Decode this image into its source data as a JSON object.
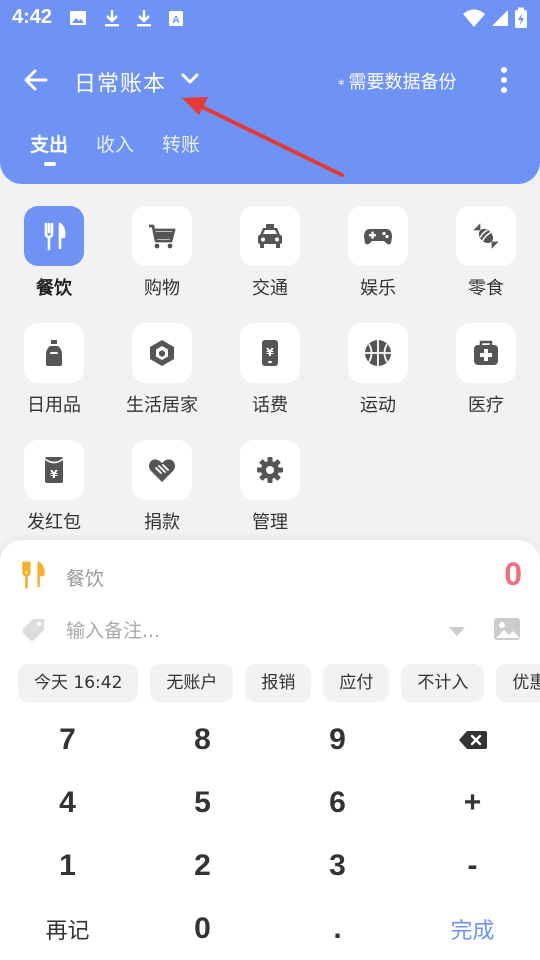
{
  "status": {
    "time": "4:42",
    "icons": [
      "image-icon",
      "download-icon",
      "download-icon",
      "font-icon",
      "wifi-icon",
      "signal-icon",
      "battery-charging-icon"
    ]
  },
  "toolbar": {
    "back_icon": "arrow-left-icon",
    "book_title": "日常账本",
    "backup_star": "⁎",
    "backup_label": "需要数据备份",
    "more_icon": "more-vertical-icon"
  },
  "tabs": [
    {
      "label": "支出",
      "active": true
    },
    {
      "label": "收入",
      "active": false
    },
    {
      "label": "转账",
      "active": false
    }
  ],
  "categories": [
    {
      "label": "餐饮",
      "icon": "utensils-icon",
      "selected": true
    },
    {
      "label": "购物",
      "icon": "cart-icon",
      "selected": false
    },
    {
      "label": "交通",
      "icon": "taxi-icon",
      "selected": false
    },
    {
      "label": "娱乐",
      "icon": "gamepad-icon",
      "selected": false
    },
    {
      "label": "零食",
      "icon": "candy-icon",
      "selected": false
    },
    {
      "label": "日用品",
      "icon": "bottle-icon",
      "selected": false
    },
    {
      "label": "生活居家",
      "icon": "cube-icon",
      "selected": false
    },
    {
      "label": "话费",
      "icon": "phone-bill-icon",
      "selected": false
    },
    {
      "label": "运动",
      "icon": "basketball-icon",
      "selected": false
    },
    {
      "label": "医疗",
      "icon": "medkit-icon",
      "selected": false
    },
    {
      "label": "发红包",
      "icon": "red-envelope-icon",
      "selected": false
    },
    {
      "label": "捐款",
      "icon": "donate-heart-icon",
      "selected": false
    },
    {
      "label": "管理",
      "icon": "gear-icon",
      "selected": false
    }
  ],
  "entry": {
    "category_name": "餐饮",
    "amount": "0",
    "note_placeholder": "输入备注...",
    "note_value": ""
  },
  "chips": [
    "今天 16:42",
    "无账户",
    "报销",
    "应付",
    "不计入",
    "优惠"
  ],
  "keypad": [
    [
      "7",
      "8",
      "9",
      "backspace"
    ],
    [
      "4",
      "5",
      "6",
      "+"
    ],
    [
      "1",
      "2",
      "3",
      "-"
    ],
    [
      "再记",
      "0",
      ".",
      "完成"
    ]
  ],
  "colors": {
    "accent": "#6f92f5",
    "amount": "#ef6f7f",
    "icon_gray": "#555555",
    "food_icon": "#f5b02e",
    "annotation": "#e53935"
  }
}
